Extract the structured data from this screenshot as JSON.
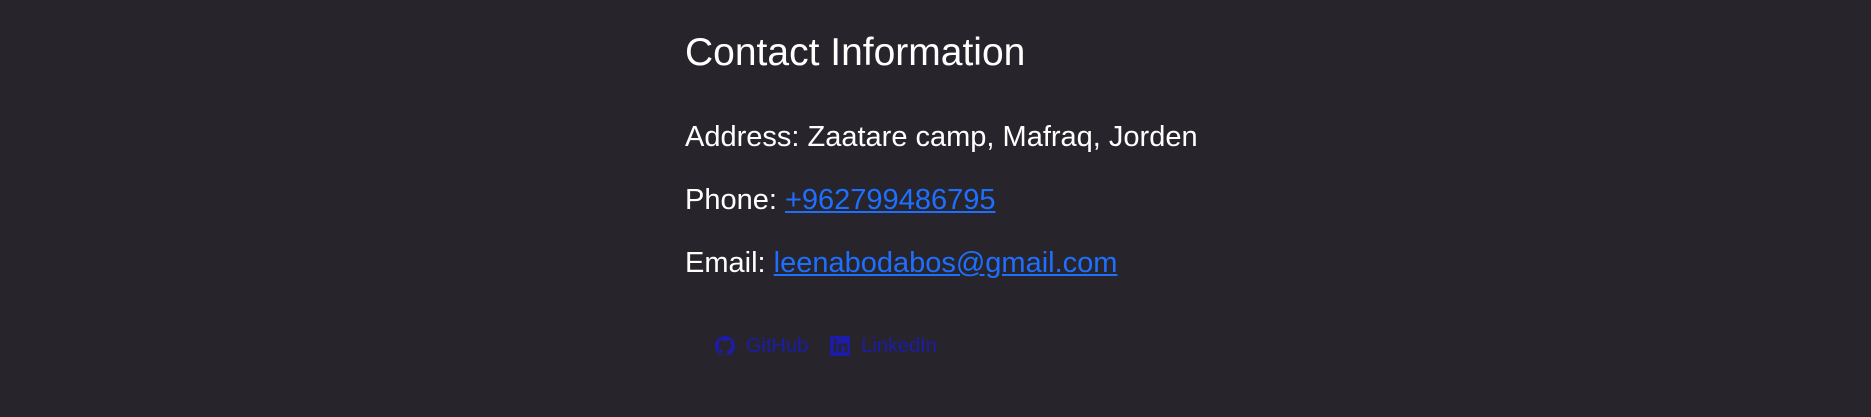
{
  "contact": {
    "title": "Contact Information",
    "address_label": "Address:",
    "address_value": "Zaatare camp, Mafraq, Jorden",
    "phone_label": "Phone:",
    "phone_value": "+962799486795",
    "email_label": "Email:",
    "email_value": "leenabodabos@gmail.com"
  },
  "social": [
    {
      "label": "GitHub",
      "icon": "github-icon"
    },
    {
      "label": "LinkedIn",
      "icon": "linkedin-icon"
    }
  ],
  "colors": {
    "background": "#27252b",
    "text": "#ffffff",
    "link": "#1f6fff",
    "social_link": "#1c1ca8"
  }
}
